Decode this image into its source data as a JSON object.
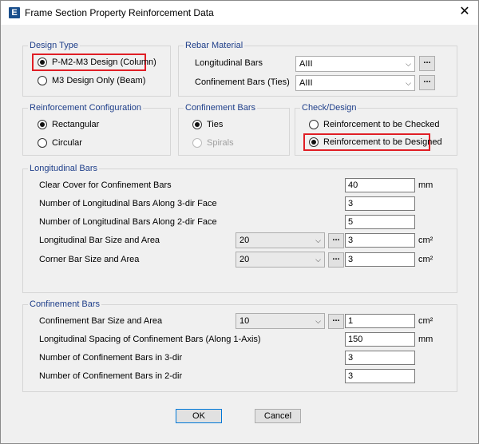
{
  "window": {
    "app_icon": "E",
    "title": "Frame Section Property Reinforcement Data",
    "close": "✕"
  },
  "design_type": {
    "label": "Design Type",
    "options": [
      "P-M2-M3 Design  (Column)",
      "M3 Design Only  (Beam)"
    ],
    "selected": 0
  },
  "rebar_material": {
    "label": "Rebar Material",
    "longitudinal_label": "Longitudinal Bars",
    "longitudinal_value": "AIII",
    "confinement_label": "Confinement Bars (Ties)",
    "confinement_value": "AIII",
    "dots": "..."
  },
  "reinforcement_configuration": {
    "label": "Reinforcement Configuration",
    "options": [
      "Rectangular",
      "Circular"
    ],
    "selected": 0
  },
  "confinement_type": {
    "label": "Confinement Bars",
    "options": [
      "Ties",
      "Spirals"
    ],
    "selected": 0
  },
  "check_design": {
    "label": "Check/Design",
    "options": [
      "Reinforcement to be Checked",
      "Reinforcement to be Designed"
    ],
    "selected": 1
  },
  "longitudinal_bars": {
    "label": "Longitudinal Bars",
    "clear_cover_label": "Clear Cover for Confinement Bars",
    "clear_cover_value": "40",
    "clear_cover_unit": "mm",
    "num_3dir_label": "Number of Longitudinal Bars Along 3-dir Face",
    "num_3dir_value": "3",
    "num_2dir_label": "Number of Longitudinal Bars Along 2-dir Face",
    "num_2dir_value": "5",
    "bar_size_label": "Longitudinal Bar Size and Area",
    "bar_size_value": "20",
    "bar_area_value": "3",
    "bar_area_unit": "cm²",
    "corner_label": "Corner Bar Size and Area",
    "corner_size_value": "20",
    "corner_area_value": "3",
    "corner_area_unit": "cm²"
  },
  "confinement_bars": {
    "label": "Confinement Bars",
    "bar_size_label": "Confinement Bar Size and Area",
    "bar_size_value": "10",
    "bar_area_value": "1",
    "bar_area_unit": "cm²",
    "spacing_label": "Longitudinal Spacing of Confinement Bars  (Along 1-Axis)",
    "spacing_value": "150",
    "spacing_unit": "mm",
    "num_3dir_label": "Number of Confinement Bars in 3-dir",
    "num_3dir_value": "3",
    "num_2dir_label": "Number of Confinement Bars in 2-dir",
    "num_2dir_value": "3"
  },
  "buttons": {
    "ok": "OK",
    "cancel": "Cancel"
  },
  "colors": {
    "highlight": "#e01e25",
    "group_label": "#1f3f8a"
  }
}
